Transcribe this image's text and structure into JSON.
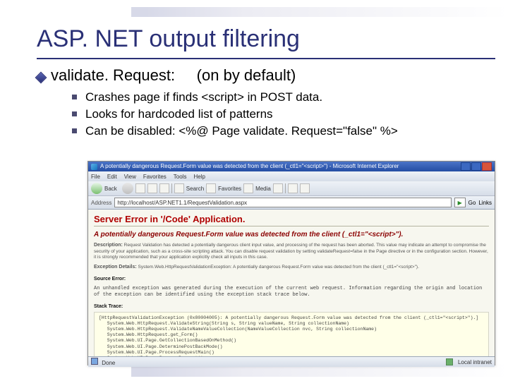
{
  "slide": {
    "title": "ASP. NET output filtering",
    "bullet": {
      "label": "validate. Request:",
      "note": "(on by default)"
    },
    "subbullets": [
      "Crashes page if finds  <script>  in POST data.",
      "Looks for hardcoded list of patterns",
      "Can be disabled:  <%@  Page  validate. Request=\"false\"  %>"
    ]
  },
  "browser": {
    "title": "A potentially dangerous Request.Form value was detected from the client (_ctl1=\"<script>\") - Microsoft Internet Explorer",
    "menus": [
      "File",
      "Edit",
      "View",
      "Favorites",
      "Tools",
      "Help"
    ],
    "toolbar": {
      "back": "Back",
      "search": "Search",
      "favorites": "Favorites",
      "media": "Media"
    },
    "address_label": "Address",
    "address": "http://localhost/ASP.NET1.1/RequestValidation.aspx",
    "go": "Go",
    "links": "Links",
    "status_left": "Done",
    "status_right": "Local intranet"
  },
  "errorpage": {
    "h1": "Server Error in '/Code' Application.",
    "h2": "A potentially dangerous Request.Form value was detected from the client (_ctl1=\"<script>\").",
    "desc_label": "Description:",
    "desc_text": "Request Validation has detected a potentially dangerous client input value, and processing of the request has been aborted. This value may indicate an attempt to compromise the security of your application, such as a cross-site scripting attack. You can disable request validation by setting validateRequest=false in the Page directive or in the configuration section. However, it is strongly recommended that your application explicitly check all inputs in this case.",
    "exc_label": "Exception Details:",
    "exc_text": "System.Web.HttpRequestValidationException: A potentially dangerous Request.Form value was detected from the client (_ctl1=\"<script>\").",
    "src_label": "Source Error:",
    "src_text": "An unhandled exception was generated during the execution of the current web request. Information regarding the origin and location of the exception can be identified using the exception stack trace below.",
    "stack_label": "Stack Trace:",
    "stack_text": "[HttpRequestValidationException (0x80004005): A potentially dangerous Request.Form value was detected from the client (_ctl1=\"<script>\").]\n   System.Web.HttpRequest.ValidateString(String s, String valueName, String collectionName)\n   System.Web.HttpRequest.ValidateNameValueCollection(NameValueCollection nvc, String collectionName)\n   System.Web.HttpRequest.get_Form()\n   System.Web.UI.Page.GetCollectionBasedOnMethod()\n   System.Web.UI.Page.DeterminePostBackMode()\n   System.Web.UI.Page.ProcessRequestMain()\n   System.Web.UI.Page.ProcessRequest()\n   System.Web.UI.Page.ProcessRequest(HttpContext context)\n   System.Web.CallHandlerExecutionStep.System.Web.HttpApplication+IExecutionStep.Execute()\n   System.Web.HttpApplication.ExecuteStep(IExecutionStep step, Boolean& completedSynchronously)"
  }
}
